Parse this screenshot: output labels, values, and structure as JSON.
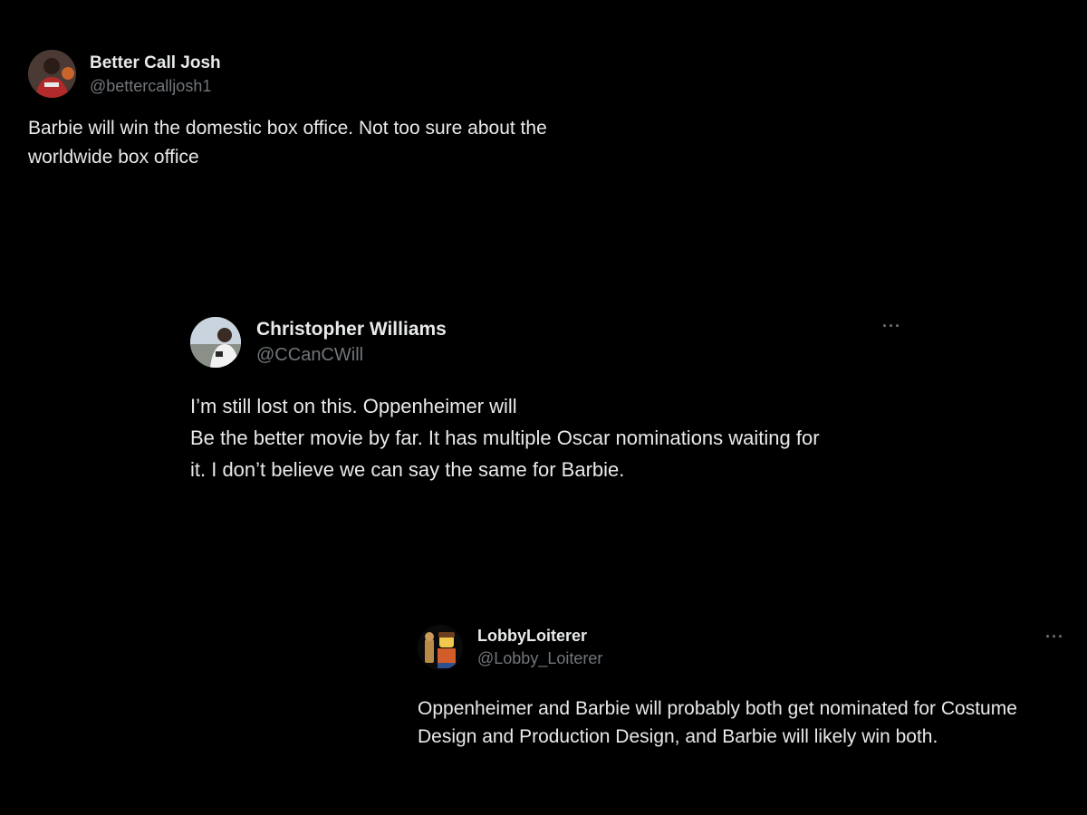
{
  "tweets": [
    {
      "display_name": "Better Call Josh",
      "handle": "@bettercalljosh1",
      "text": "Barbie will win the domestic box office. Not too sure about the\nworldwide box office",
      "avatar_icon": "profile-photo"
    },
    {
      "display_name": "Christopher Williams",
      "handle": "@CCanCWill",
      "text": "I’m still lost on this. Oppenheimer will\nBe the better movie by far. It has multiple Oscar nominations waiting for\nit. I don’t believe we can say the same for Barbie.",
      "more_label": "···",
      "avatar_icon": "profile-photo"
    },
    {
      "display_name": "LobbyLoiterer",
      "handle": "@Lobby_Loiterer",
      "text": "Oppenheimer and Barbie will probably both get nominated for Costume\nDesign and Production Design, and Barbie will likely win both.",
      "more_label": "···",
      "avatar_icon": "lego-figure-photo"
    }
  ],
  "colors": {
    "background": "#000000",
    "primary_text": "#e7e9ea",
    "secondary_text": "#71767b"
  }
}
